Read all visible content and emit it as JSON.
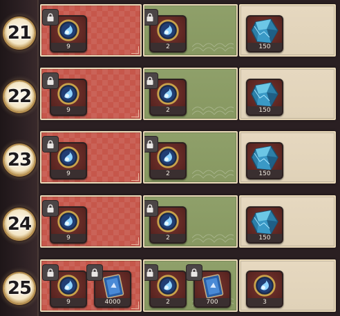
{
  "rows": [
    {
      "level": "21",
      "red": [
        {
          "icon": "blue-orb-icon",
          "qty": "9",
          "locked": true
        }
      ],
      "green": [
        {
          "icon": "blue-orb-icon",
          "qty": "2",
          "locked": true
        }
      ],
      "beige": [
        {
          "icon": "blue-crystal-icon",
          "qty": "150",
          "locked": false
        }
      ]
    },
    {
      "level": "22",
      "red": [
        {
          "icon": "blue-orb-icon",
          "qty": "9",
          "locked": true
        }
      ],
      "green": [
        {
          "icon": "blue-orb-icon",
          "qty": "2",
          "locked": true
        }
      ],
      "beige": [
        {
          "icon": "blue-crystal-icon",
          "qty": "150",
          "locked": false
        }
      ]
    },
    {
      "level": "23",
      "red": [
        {
          "icon": "blue-orb-icon",
          "qty": "9",
          "locked": true
        }
      ],
      "green": [
        {
          "icon": "blue-orb-icon",
          "qty": "2",
          "locked": true
        }
      ],
      "beige": [
        {
          "icon": "blue-crystal-icon",
          "qty": "150",
          "locked": false
        }
      ]
    },
    {
      "level": "24",
      "red": [
        {
          "icon": "blue-orb-icon",
          "qty": "9",
          "locked": true
        }
      ],
      "green": [
        {
          "icon": "blue-orb-icon",
          "qty": "2",
          "locked": true
        }
      ],
      "beige": [
        {
          "icon": "blue-crystal-icon",
          "qty": "150",
          "locked": false
        }
      ]
    },
    {
      "level": "25",
      "red": [
        {
          "icon": "blue-orb-icon",
          "qty": "9",
          "locked": true
        },
        {
          "icon": "blue-card-icon",
          "qty": "4000",
          "locked": true
        }
      ],
      "green": [
        {
          "icon": "blue-orb-icon",
          "qty": "2",
          "locked": true
        },
        {
          "icon": "blue-card-icon",
          "qty": "700",
          "locked": true
        }
      ],
      "beige": [
        {
          "icon": "blue-orb-icon",
          "qty": "3",
          "locked": false
        }
      ]
    }
  ],
  "colors": {
    "free_track": "#c6574b",
    "premium_track": "#8fa06a",
    "bonus_track": "#e6d8c0"
  }
}
